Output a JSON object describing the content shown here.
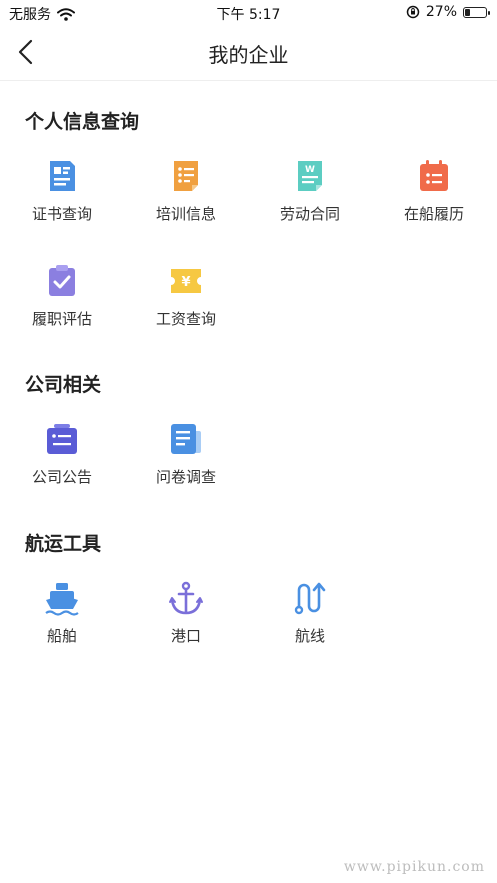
{
  "status_bar": {
    "carrier": "无服务",
    "time": "下午 5:17",
    "battery": "27%",
    "battery_level": 0.27
  },
  "nav": {
    "title": "我的企业"
  },
  "sections": [
    {
      "title": "个人信息查询",
      "items": [
        {
          "label": "证书查询",
          "icon": "certificate-icon"
        },
        {
          "label": "培训信息",
          "icon": "training-icon"
        },
        {
          "label": "劳动合同",
          "icon": "contract-icon"
        },
        {
          "label": "在船履历",
          "icon": "calendar-icon"
        },
        {
          "label": "履职评估",
          "icon": "clipboard-check-icon"
        },
        {
          "label": "工资查询",
          "icon": "salary-ticket-icon"
        }
      ]
    },
    {
      "title": "公司相关",
      "items": [
        {
          "label": "公司公告",
          "icon": "announcement-icon"
        },
        {
          "label": "问卷调查",
          "icon": "survey-icon"
        }
      ]
    },
    {
      "title": "航运工具",
      "items": [
        {
          "label": "船舶",
          "icon": "ship-icon"
        },
        {
          "label": "港口",
          "icon": "anchor-icon"
        },
        {
          "label": "航线",
          "icon": "route-icon"
        }
      ]
    }
  ],
  "watermark": "www.pipikun.com",
  "colors": {
    "blue": "#4a90e2",
    "orange": "#f0a040",
    "teal": "#5ccdc2",
    "red": "#f06b4a",
    "purple": "#8b7fe0",
    "yellow": "#f6c842",
    "indigo": "#5a5cd6"
  }
}
